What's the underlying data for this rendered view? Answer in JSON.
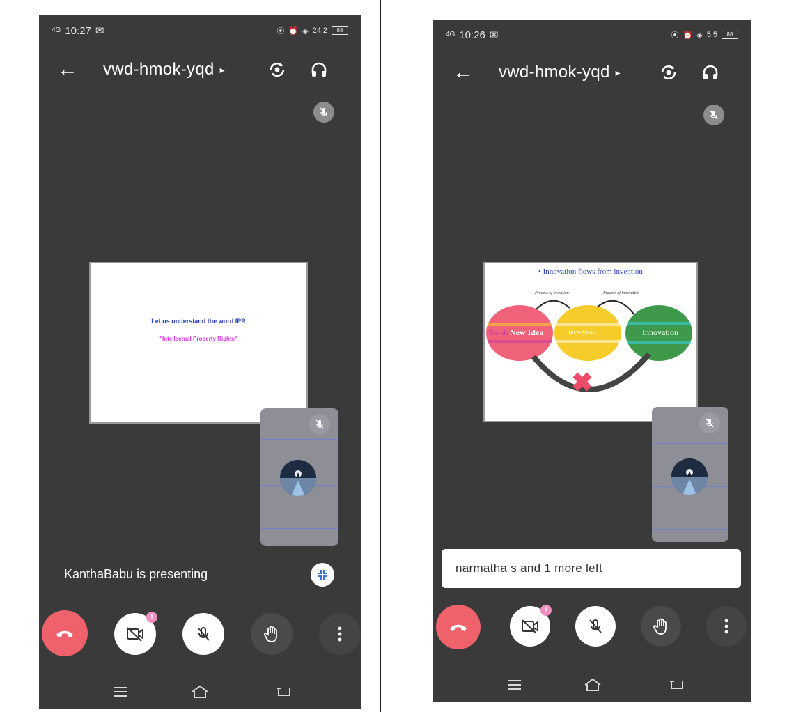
{
  "left": {
    "status": {
      "time": "10:27",
      "signal": "4G",
      "speed": "24.2",
      "battery": "88"
    },
    "meeting_code": "vwd-hmok-yqd",
    "slide": {
      "line1": "Let us understand the word IPR",
      "line2": "\"Intellectual Property Rights\""
    },
    "presenting_text": "KanthaBabu is presenting"
  },
  "right": {
    "status": {
      "time": "10:26",
      "signal": "4G",
      "speed": "5.5",
      "battery": "88"
    },
    "meeting_code": "vwd-hmok-yqd",
    "slide": {
      "bullet": "• Innovation flows from invention",
      "label_a": "Process of invention",
      "label_b": "Process of innovation",
      "circle1_a": "Trends",
      "circle1_b": "New Idea",
      "circle2": "Inventions",
      "circle3": "Innovation"
    },
    "notification": "narmatha s and 1 more left"
  },
  "icons": {
    "back": "arrow-left-icon",
    "switch_camera": "switch-camera-icon",
    "audio": "headphones-icon",
    "mic_off": "mic-off-icon",
    "hangup": "phone-hangup-icon",
    "camera_off": "video-off-icon",
    "raise_hand": "raise-hand-icon",
    "more": "more-vert-icon",
    "fullscreen_exit": "fullscreen-exit-icon"
  },
  "colors": {
    "phone_bg": "#3a3a3a",
    "hangup": "#f0626b",
    "control_white": "#ffffff",
    "control_dark": "#4a4a4a",
    "slide_title_blue": "#2a3fb8",
    "slide_subtitle_pink": "#d23ae0",
    "circle_pink": "#f0627a",
    "circle_yellow": "#f5cc2a",
    "circle_green": "#3e9a4a",
    "cross_pink": "#f04a6a"
  }
}
